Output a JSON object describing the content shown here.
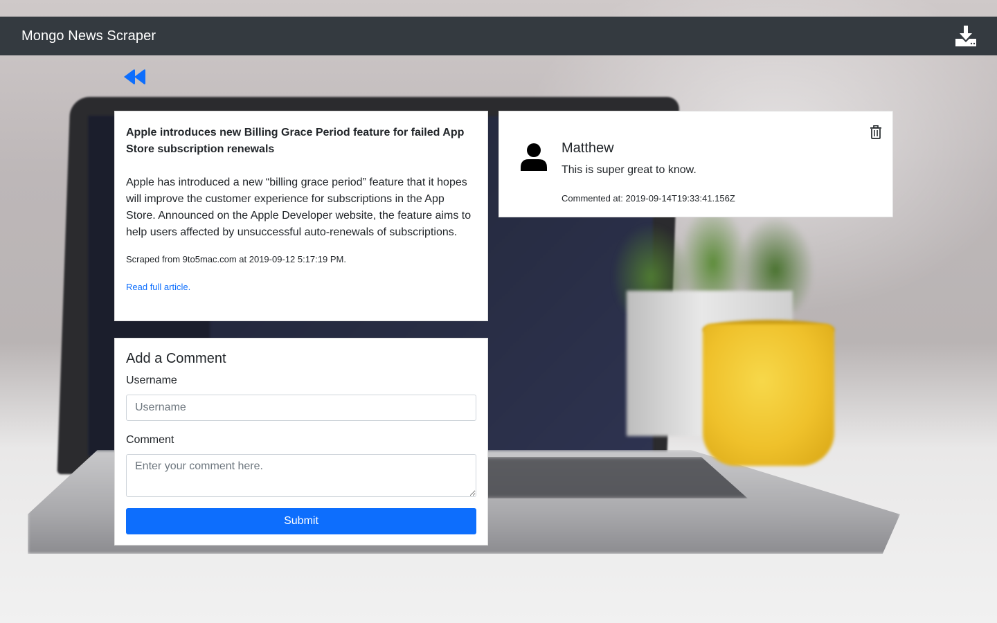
{
  "app": {
    "brand": "Mongo News Scraper"
  },
  "icons": {
    "download": "download-icon",
    "back": "backward-icon",
    "avatar": "user-icon",
    "delete": "trash-icon"
  },
  "colors": {
    "navbar": "#343a40",
    "primary": "#0d6efd",
    "card": "#ffffff"
  },
  "article": {
    "title": "Apple introduces new Billing Grace Period feature for failed App Store subscription renewals",
    "summary": "Apple has introduced a new “billing grace period” feature that it hopes will improve the customer experience for subscriptions in the App Store. Announced on the Apple Developer website, the feature aims to help users affected by unsuccessful auto-renewals of subscriptions.",
    "meta": "Scraped from 9to5mac.com at 2019-09-12 5:17:19 PM.",
    "link_label": "Read full article."
  },
  "comment_form": {
    "heading": "Add a Comment",
    "username_label": "Username",
    "username_placeholder": "Username",
    "comment_label": "Comment",
    "comment_placeholder": "Enter your comment here.",
    "submit_label": "Submit"
  },
  "comments": [
    {
      "user": "Matthew",
      "text": "This is super great to know.",
      "time": "Commented at: 2019-09-14T19:33:41.156Z"
    }
  ]
}
